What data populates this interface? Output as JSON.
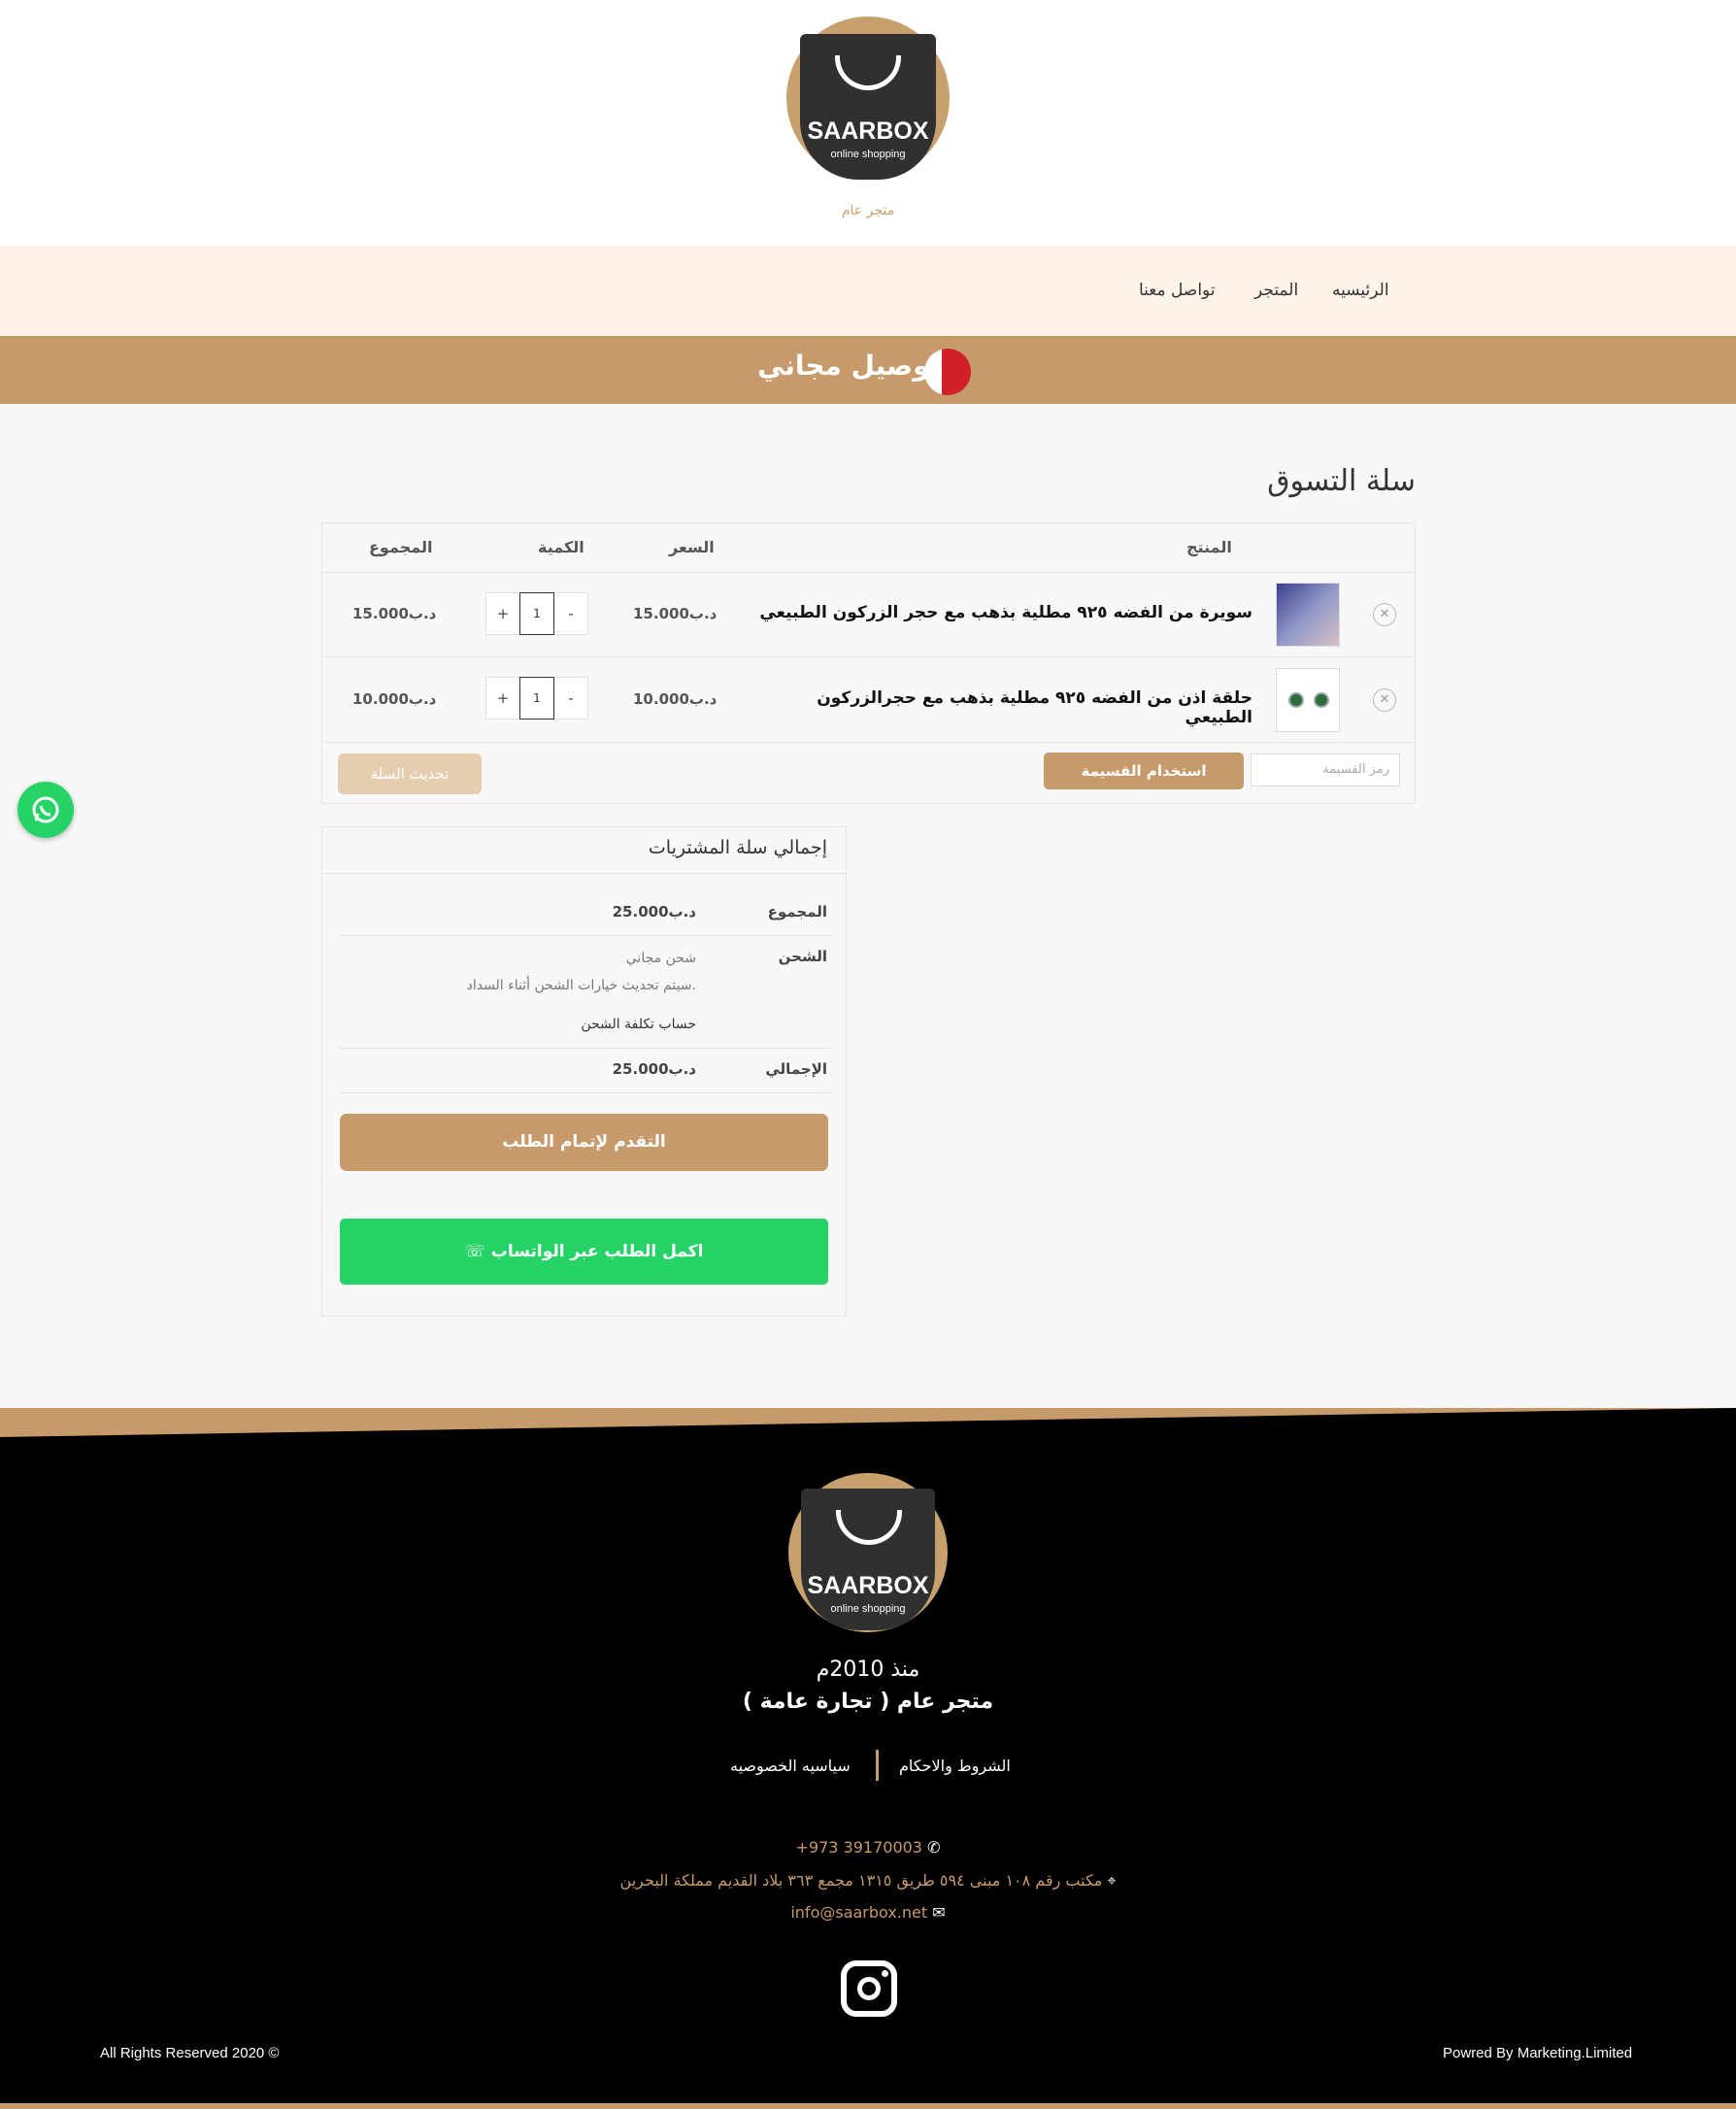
{
  "header": {
    "logo": {
      "name": "SAARBOX",
      "subtitle": "online shopping"
    },
    "tagline": "متجر عام"
  },
  "nav": {
    "items": [
      {
        "label": "الرئيسيه"
      },
      {
        "label": "المتجر"
      },
      {
        "label": "تواصل معنا"
      }
    ]
  },
  "banner": {
    "text": "توصيل مجاني"
  },
  "cart": {
    "title": "سلة التسوق",
    "columns": {
      "product": "المنتج",
      "price": "السعر",
      "quantity": "الكمية",
      "subtotal": "المجموع"
    },
    "items": [
      {
        "name": "سويرة من الفضه ٩٢٥ مطلية بذهب مع حجر الزركون الطبيعي",
        "price": "15.000د.ب",
        "quantity": "1",
        "subtotal": "15.000د.ب",
        "minus": "-",
        "plus": "+"
      },
      {
        "name": "حلقة اذن من الفضه ٩٢٥ مطلية بذهب مع حجرالزركون الطبيعي",
        "price": "10.000د.ب",
        "quantity": "1",
        "subtotal": "10.000د.ب",
        "minus": "-",
        "plus": "+"
      }
    ],
    "coupon_placeholder": "رمز القسيمة",
    "apply_coupon_label": "استخدام القسيمة",
    "update_cart_label": "تحديث السلة"
  },
  "totals": {
    "title": "إجمالي سلة المشتريات",
    "subtotal_label": "المجموع",
    "subtotal_value": "25.000د.ب",
    "shipping_label": "الشحن",
    "shipping_value": "شحن مجاني",
    "shipping_note": "سيتم تحديث خيارات الشحن أثناء السداد.",
    "shipping_calc": "حساب تكلفة الشحن",
    "total_label": "الإجمالي",
    "total_value": "25.000د.ب",
    "checkout_label": "التقدم لإتمام الطلب",
    "whatsapp_label": "اكمل الطلب عبر الواتساب"
  },
  "footer": {
    "since": "منذ 2010م",
    "store": "متجر عام ( تجارة عامة )",
    "links": {
      "terms": "الشروط والاحكام",
      "privacy": "سياسيه الخصوصيه"
    },
    "phone": "+973 39170003",
    "address": "مكتب رقم ١٠٨ مبنى ٥٩٤ طريق ١٣١٥ مجمع ٣٦٣ بلاد القديم مملكة البحرين",
    "email": "info@saarbox.net",
    "copyright": "All Rights Reserved 2020 ©",
    "powered": "Powred By Marketing.Limited"
  },
  "icons": {
    "phone": "phone-icon",
    "location": "map-pin-icon",
    "email": "envelope-icon",
    "instagram": "instagram-icon",
    "whatsapp": "whatsapp-icon"
  },
  "colors": {
    "brand": "#c69a6a",
    "nav_bg": "#fdf3e7",
    "whatsapp": "#25d366",
    "footer_bg": "#000000"
  }
}
